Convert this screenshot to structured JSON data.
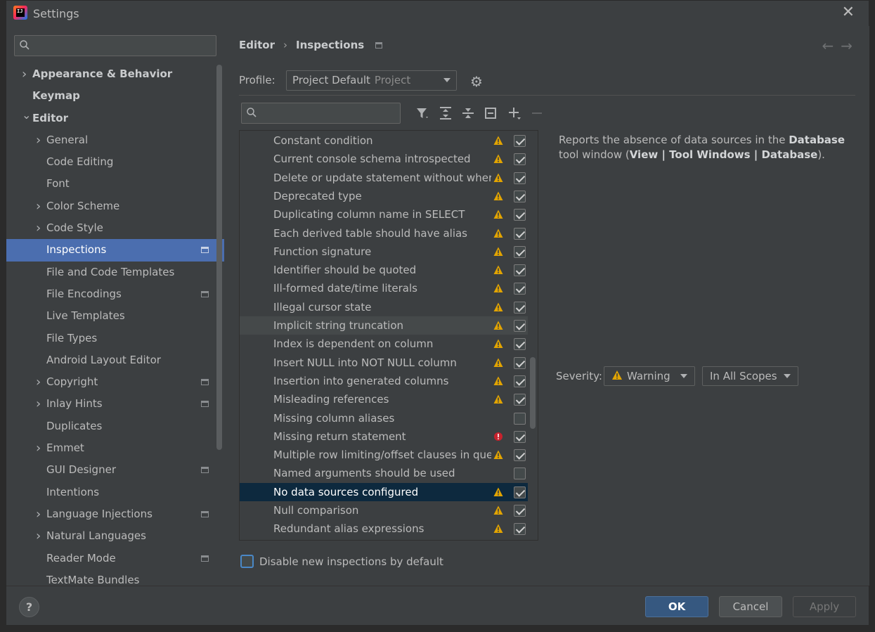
{
  "window": {
    "title": "Settings",
    "app_icon_text": "IJ"
  },
  "sidebar": {
    "search_placeholder": "",
    "items": [
      {
        "label": "Appearance & Behavior",
        "level": 0,
        "chevron": "right",
        "bold": true,
        "project": false
      },
      {
        "label": "Keymap",
        "level": 0,
        "chevron": "none",
        "bold": true,
        "project": false
      },
      {
        "label": "Editor",
        "level": 0,
        "chevron": "down",
        "bold": true,
        "project": false
      },
      {
        "label": "General",
        "level": 1,
        "chevron": "right",
        "bold": false,
        "project": false
      },
      {
        "label": "Code Editing",
        "level": 1,
        "chevron": "none",
        "bold": false,
        "project": false
      },
      {
        "label": "Font",
        "level": 1,
        "chevron": "none",
        "bold": false,
        "project": false
      },
      {
        "label": "Color Scheme",
        "level": 1,
        "chevron": "right",
        "bold": false,
        "project": false
      },
      {
        "label": "Code Style",
        "level": 1,
        "chevron": "right",
        "bold": false,
        "project": false
      },
      {
        "label": "Inspections",
        "level": 1,
        "chevron": "none",
        "bold": false,
        "project": true,
        "selected": true
      },
      {
        "label": "File and Code Templates",
        "level": 1,
        "chevron": "none",
        "bold": false,
        "project": false
      },
      {
        "label": "File Encodings",
        "level": 1,
        "chevron": "none",
        "bold": false,
        "project": true
      },
      {
        "label": "Live Templates",
        "level": 1,
        "chevron": "none",
        "bold": false,
        "project": false
      },
      {
        "label": "File Types",
        "level": 1,
        "chevron": "none",
        "bold": false,
        "project": false
      },
      {
        "label": "Android Layout Editor",
        "level": 1,
        "chevron": "none",
        "bold": false,
        "project": false
      },
      {
        "label": "Copyright",
        "level": 1,
        "chevron": "right",
        "bold": false,
        "project": true
      },
      {
        "label": "Inlay Hints",
        "level": 1,
        "chevron": "right",
        "bold": false,
        "project": true
      },
      {
        "label": "Duplicates",
        "level": 1,
        "chevron": "none",
        "bold": false,
        "project": false
      },
      {
        "label": "Emmet",
        "level": 1,
        "chevron": "right",
        "bold": false,
        "project": false
      },
      {
        "label": "GUI Designer",
        "level": 1,
        "chevron": "none",
        "bold": false,
        "project": true
      },
      {
        "label": "Intentions",
        "level": 1,
        "chevron": "none",
        "bold": false,
        "project": false
      },
      {
        "label": "Language Injections",
        "level": 1,
        "chevron": "right",
        "bold": false,
        "project": true
      },
      {
        "label": "Natural Languages",
        "level": 1,
        "chevron": "right",
        "bold": false,
        "project": false
      },
      {
        "label": "Reader Mode",
        "level": 1,
        "chevron": "none",
        "bold": false,
        "project": true
      },
      {
        "label": "TextMate Bundles",
        "level": 1,
        "chevron": "none",
        "bold": false,
        "project": false
      }
    ]
  },
  "breadcrumb": {
    "parent": "Editor",
    "separator": "›",
    "current": "Inspections"
  },
  "profile": {
    "label": "Profile:",
    "value": "Project Default",
    "scope": "Project"
  },
  "inspections": [
    {
      "name": "Constant condition",
      "severity": "warning",
      "checked": true
    },
    {
      "name": "Current console schema introspected",
      "severity": "warning",
      "checked": true
    },
    {
      "name": "Delete or update statement without where clauses",
      "severity": "warning",
      "checked": true
    },
    {
      "name": "Deprecated type",
      "severity": "warning",
      "checked": true
    },
    {
      "name": "Duplicating column name in SELECT",
      "severity": "warning",
      "checked": true
    },
    {
      "name": "Each derived table should have alias",
      "severity": "warning",
      "checked": true
    },
    {
      "name": "Function signature",
      "severity": "warning",
      "checked": true
    },
    {
      "name": "Identifier should be quoted",
      "severity": "warning",
      "checked": true
    },
    {
      "name": "Ill-formed date/time literals",
      "severity": "warning",
      "checked": true
    },
    {
      "name": "Illegal cursor state",
      "severity": "warning",
      "checked": true
    },
    {
      "name": "Implicit string truncation",
      "severity": "warning",
      "checked": true,
      "hover": true
    },
    {
      "name": "Index is dependent on column",
      "severity": "warning",
      "checked": true
    },
    {
      "name": "Insert NULL into NOT NULL column",
      "severity": "warning",
      "checked": true
    },
    {
      "name": "Insertion into generated columns",
      "severity": "warning",
      "checked": true
    },
    {
      "name": "Misleading references",
      "severity": "warning",
      "checked": true
    },
    {
      "name": "Missing column aliases",
      "severity": "none",
      "checked": false
    },
    {
      "name": "Missing return statement",
      "severity": "error",
      "checked": true
    },
    {
      "name": "Multiple row limiting/offset clauses in queries",
      "severity": "warning",
      "checked": true
    },
    {
      "name": "Named arguments should be used",
      "severity": "none",
      "checked": false
    },
    {
      "name": "No data sources configured",
      "severity": "warning",
      "checked": true,
      "selected": true
    },
    {
      "name": "Null comparison",
      "severity": "warning",
      "checked": true
    },
    {
      "name": "Redundant alias expressions",
      "severity": "warning",
      "checked": true
    }
  ],
  "description": {
    "part1": "Reports the absence of data sources in the ",
    "bold1": "Database",
    "part2": " tool window (",
    "bold2": "View | Tool Windows | Database",
    "part3": ")."
  },
  "severity_panel": {
    "label": "Severity:",
    "severity_value": "Warning",
    "scope_value": "In All Scopes"
  },
  "disable_new": {
    "label": "Disable new inspections by default",
    "checked": false
  },
  "footer": {
    "help": "?",
    "ok": "OK",
    "cancel": "Cancel",
    "apply": "Apply"
  },
  "colors": {
    "accent": "#4b6eaf",
    "warning": "#e2a400",
    "error": "#c7222d",
    "selected_row": "#0d293e"
  }
}
